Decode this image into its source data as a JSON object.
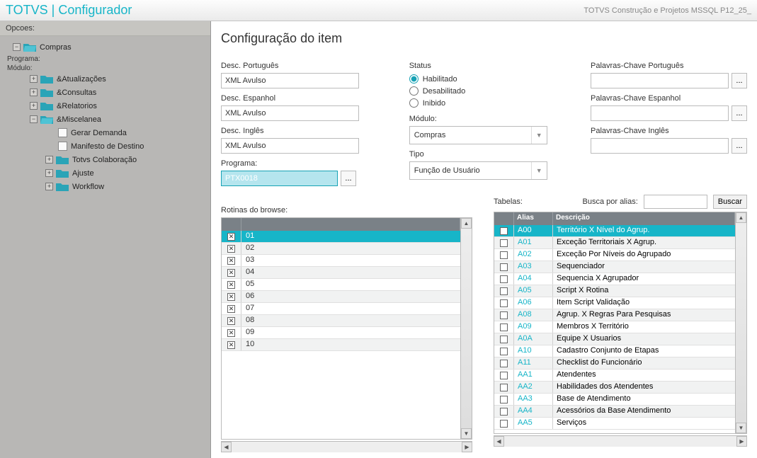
{
  "header": {
    "title": "TOTVS | Configurador",
    "env": "TOTVS Construção e Projetos MSSQL P12_25_"
  },
  "sidebar": {
    "opcoes_label": "Opcoes:",
    "root": "Compras",
    "programa_label": "Programa:",
    "modulo_label": "Módulo:",
    "items": [
      {
        "label": "&Atualizações"
      },
      {
        "label": "&Consultas"
      },
      {
        "label": "&Relatorios"
      },
      {
        "label": "&Miscelanea"
      }
    ],
    "misc_children": [
      {
        "label": "Gerar Demanda",
        "leaf": true
      },
      {
        "label": "Manifesto de Destino",
        "leaf": true
      },
      {
        "label": "Totvs Colaboração",
        "leaf": false
      },
      {
        "label": "Ajuste",
        "leaf": false
      },
      {
        "label": "Workflow",
        "leaf": false
      }
    ]
  },
  "page": {
    "title": "Configuração do item"
  },
  "form": {
    "desc_pt_label": "Desc. Português",
    "desc_pt_value": "XML Avulso",
    "desc_es_label": "Desc. Espanhol",
    "desc_es_value": "XML Avulso",
    "desc_en_label": "Desc. Inglês",
    "desc_en_value": "XML Avulso",
    "programa_label": "Programa:",
    "programa_value": "PTX0018",
    "status_label": "Status",
    "status_options": {
      "habilitado": "Habilitado",
      "desabilitado": "Desabilitado",
      "inibido": "Inibido"
    },
    "modulo_label": "Módulo:",
    "modulo_value": "Compras",
    "tipo_label": "Tipo",
    "tipo_value": "Função de Usuário",
    "kw_pt_label": "Palavras-Chave Português",
    "kw_es_label": "Palavras-Chave Espanhol",
    "kw_en_label": "Palavras-Chave Inglês"
  },
  "rotinas": {
    "label": "Rotinas do browse:",
    "rows": [
      "01",
      "02",
      "03",
      "04",
      "05",
      "06",
      "07",
      "08",
      "09",
      "10"
    ]
  },
  "tabelas": {
    "label": "Tabelas:",
    "busca_label": "Busca por alias:",
    "buscar_btn": "Buscar",
    "headers": {
      "alias": "Alias",
      "desc": "Descrição"
    },
    "rows": [
      {
        "alias": "A00",
        "desc": "Território X Nível do Agrup."
      },
      {
        "alias": "A01",
        "desc": "Exceção Territoriais X Agrup."
      },
      {
        "alias": "A02",
        "desc": "Exceção Por Níveis do Agrupado"
      },
      {
        "alias": "A03",
        "desc": "Sequenciador"
      },
      {
        "alias": "A04",
        "desc": "Sequencia X Agrupador"
      },
      {
        "alias": "A05",
        "desc": "Script X Rotina"
      },
      {
        "alias": "A06",
        "desc": "Item Script Validação"
      },
      {
        "alias": "A08",
        "desc": "Agrup. X Regras Para Pesquisas"
      },
      {
        "alias": "A09",
        "desc": "Membros X Território"
      },
      {
        "alias": "A0A",
        "desc": "Equipe X Usuarios"
      },
      {
        "alias": "A10",
        "desc": "Cadastro Conjunto de Etapas"
      },
      {
        "alias": "A11",
        "desc": "Checklist do Funcionário"
      },
      {
        "alias": "AA1",
        "desc": "Atendentes"
      },
      {
        "alias": "AA2",
        "desc": "Habilidades dos Atendentes"
      },
      {
        "alias": "AA3",
        "desc": "Base de Atendimento"
      },
      {
        "alias": "AA4",
        "desc": "Acessórios da Base Atendimento"
      },
      {
        "alias": "AA5",
        "desc": "Serviços"
      }
    ]
  }
}
